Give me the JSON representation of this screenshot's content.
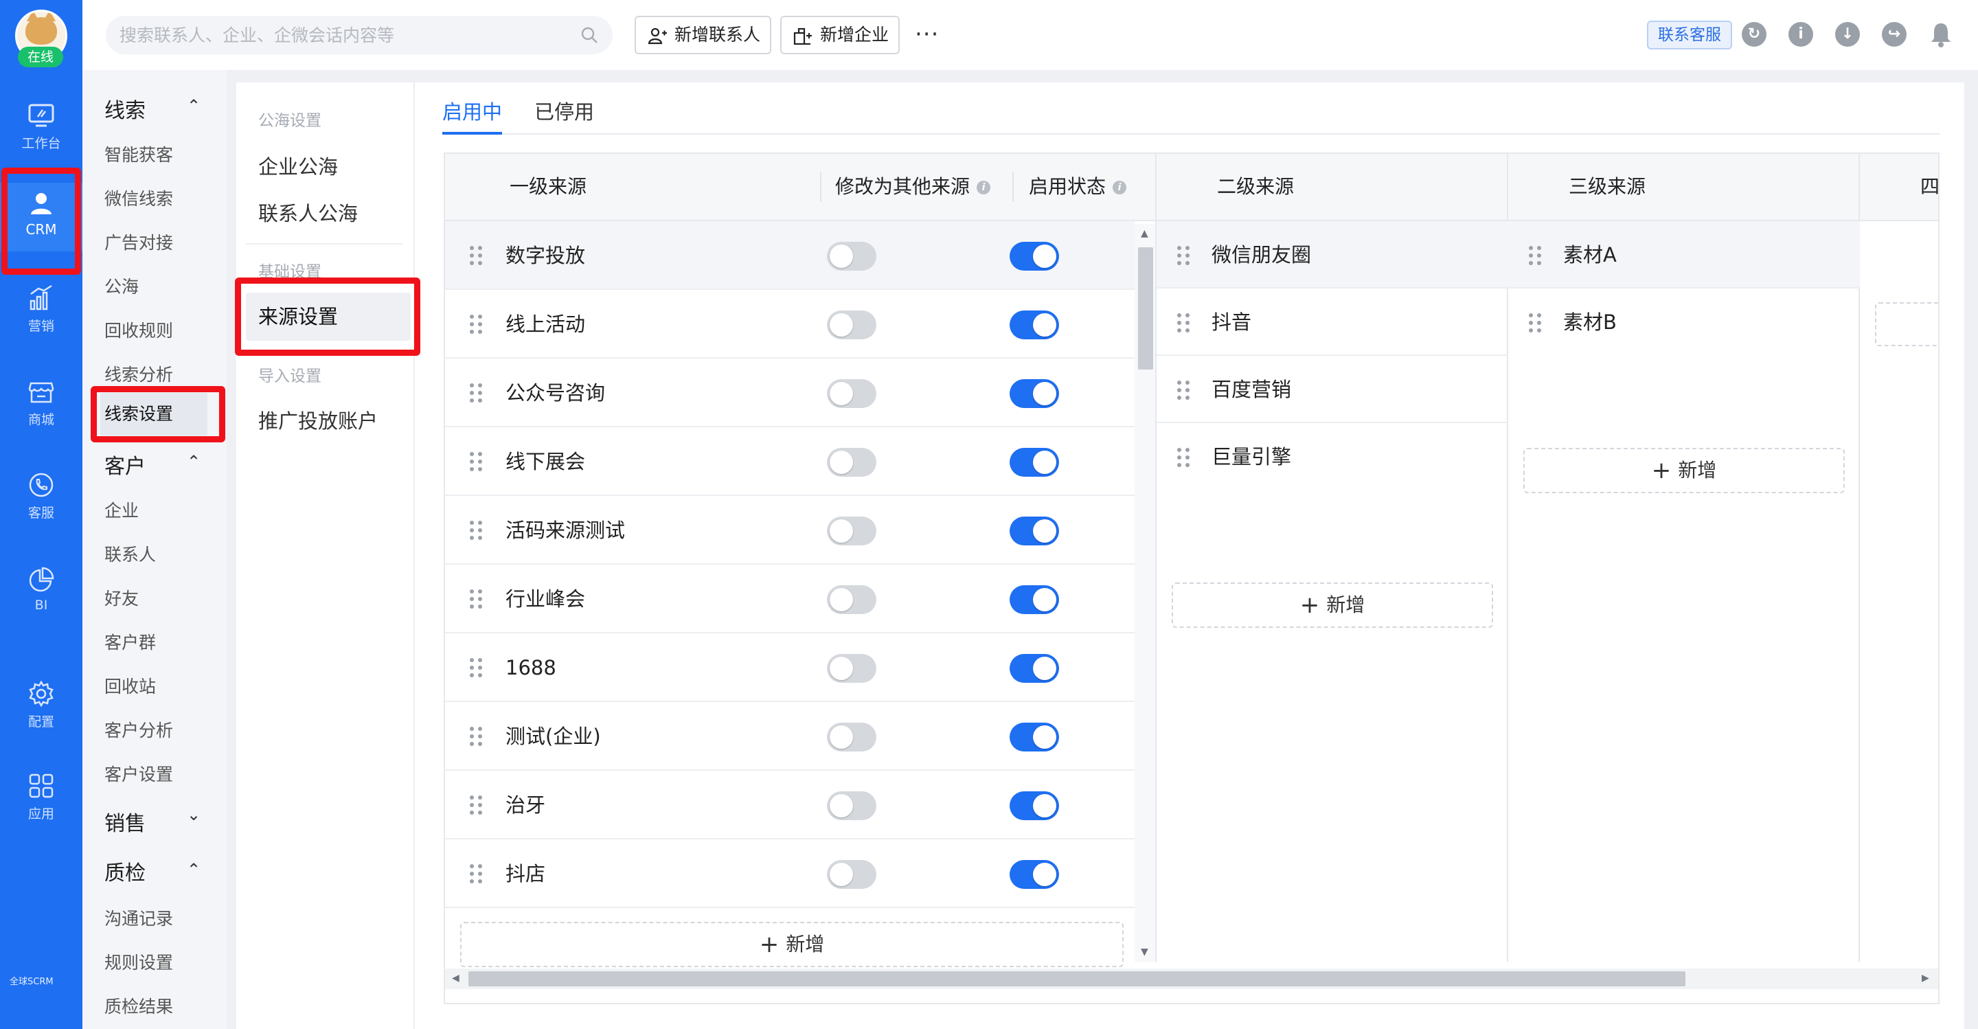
{
  "rail": {
    "status": "在线",
    "items": [
      {
        "label": "工作台"
      },
      {
        "label": "CRM"
      },
      {
        "label": "营销"
      },
      {
        "label": "商城"
      },
      {
        "label": "客服"
      },
      {
        "label": "BI"
      },
      {
        "label": "配置"
      },
      {
        "label": "应用"
      }
    ],
    "brand": "全球SCRM"
  },
  "topbar": {
    "search_placeholder": "搜索联系人、企业、企微会话内容等",
    "add_contact": "新增联系人",
    "add_company": "新增企业",
    "more": "···",
    "service": "联系客服"
  },
  "nav": {
    "clue": {
      "title": "线索",
      "items": [
        "智能获客",
        "微信线索",
        "广告对接",
        "公海",
        "回收规则",
        "线索分析",
        "线索设置"
      ]
    },
    "customer": {
      "title": "客户",
      "items": [
        "企业",
        "联系人",
        "好友",
        "客户群",
        "回收站",
        "客户分析",
        "客户设置"
      ]
    },
    "sales": {
      "title": "销售"
    },
    "qa": {
      "title": "质检",
      "items": [
        "沟通记录",
        "规则设置",
        "质检结果"
      ]
    }
  },
  "subnav": {
    "cap_sea": "公海设置",
    "company_sea": "企业公海",
    "contact_sea": "联系人公海",
    "cap_basic": "基础设置",
    "source_settings": "来源设置",
    "cap_import": "导入设置",
    "ad_account": "推广投放账户"
  },
  "tabs": {
    "active": "启用中",
    "inactive": "已停用"
  },
  "table": {
    "headers": {
      "level1": "一级来源",
      "change_to_other": "修改为其他来源",
      "enabled": "启用状态",
      "level2": "二级来源",
      "level3": "三级来源",
      "level4": "四"
    },
    "level1_rows": [
      {
        "name": "数字投放",
        "change": false,
        "enabled": true
      },
      {
        "name": "线上活动",
        "change": false,
        "enabled": true
      },
      {
        "name": "公众号咨询",
        "change": false,
        "enabled": true
      },
      {
        "name": "线下展会",
        "change": false,
        "enabled": true
      },
      {
        "name": "活码来源测试",
        "change": false,
        "enabled": true
      },
      {
        "name": "行业峰会",
        "change": false,
        "enabled": true
      },
      {
        "name": "1688",
        "change": false,
        "enabled": true
      },
      {
        "name": "测试(企业)",
        "change": false,
        "enabled": true
      },
      {
        "name": "治牙",
        "change": false,
        "enabled": true
      },
      {
        "name": "抖店",
        "change": false,
        "enabled": true
      }
    ],
    "level2_rows": [
      "微信朋友圈",
      "抖音",
      "百度营销",
      "巨量引擎"
    ],
    "level3_rows": [
      "素材A",
      "素材B"
    ],
    "add_label": "新增"
  },
  "colors": {
    "primary": "#1e6ff1",
    "highlight": "#f0121a",
    "online": "#18c06b"
  }
}
